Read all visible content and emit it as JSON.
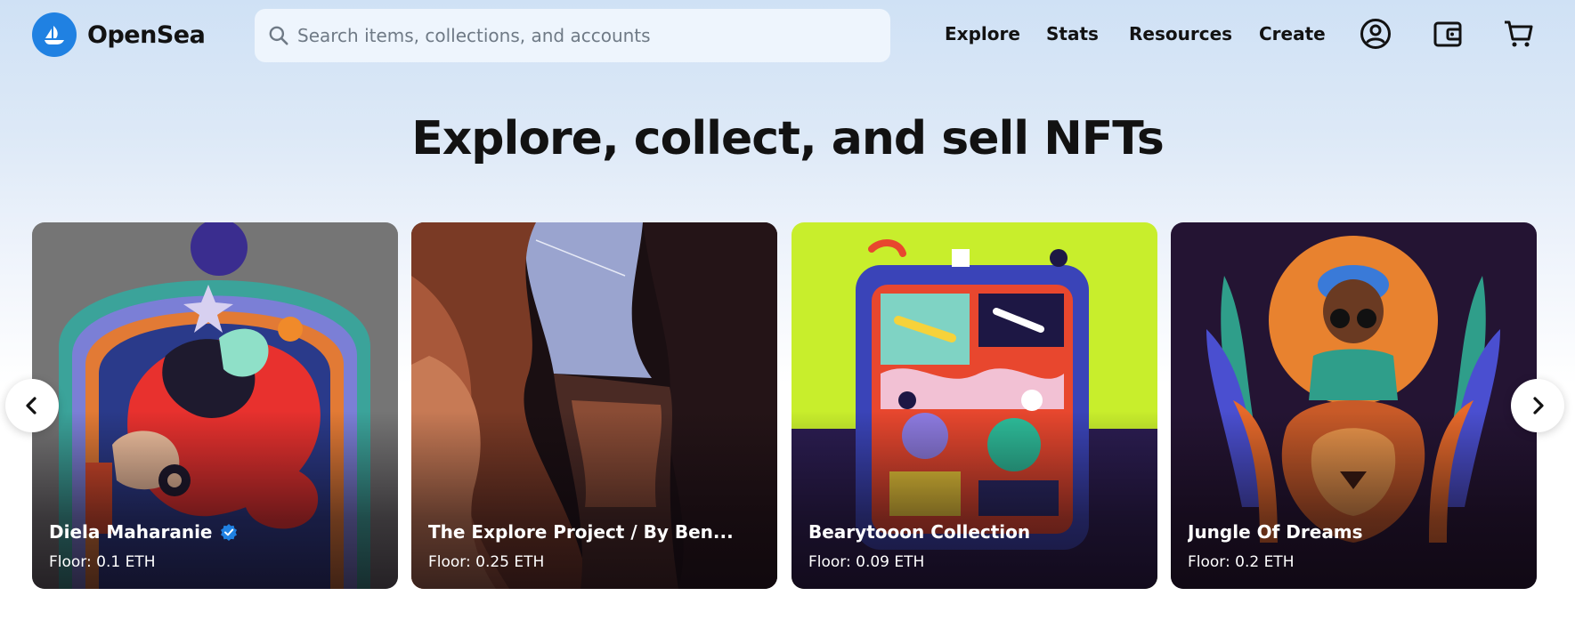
{
  "brand": {
    "name": "OpenSea",
    "logo_icon": "sailboat-logo-icon",
    "logo_color": "#2081e2"
  },
  "search": {
    "placeholder": "Search items, collections, and accounts",
    "value": ""
  },
  "nav": {
    "links": [
      "Explore",
      "Stats",
      "Resources",
      "Create"
    ],
    "icons": [
      "account-icon",
      "wallet-icon",
      "cart-icon"
    ]
  },
  "hero": {
    "title": "Explore, collect, and sell NFTs"
  },
  "carousel": {
    "prev_icon": "chevron-left-icon",
    "next_icon": "chevron-right-icon",
    "cards": [
      {
        "name": "Diela Maharanie",
        "floor": "Floor: 0.1 ETH",
        "verified": true
      },
      {
        "name": "The Explore Project / By Ben...",
        "floor": "Floor: 0.25 ETH",
        "verified": false
      },
      {
        "name": "Bearytooon Collection",
        "floor": "Floor: 0.09 ETH",
        "verified": false
      },
      {
        "name": "Jungle Of Dreams",
        "floor": "Floor: 0.2 ETH",
        "verified": false
      }
    ]
  },
  "colors": {
    "text": "#121212",
    "verified_badge": "#2081e2"
  }
}
